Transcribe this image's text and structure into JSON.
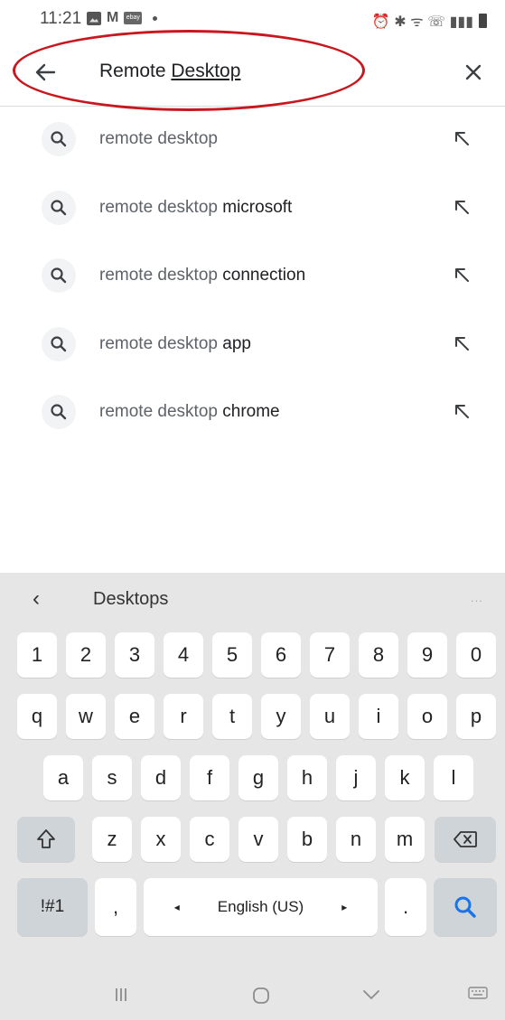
{
  "status_bar": {
    "time": "11:21",
    "gmail_icon": "M",
    "ebay_icon": "ebay",
    "right_icons": "⏰ ✱ ᯤ ☏ ▮▮▮"
  },
  "search": {
    "query_part1": "Remote ",
    "query_part2": "Desktop"
  },
  "suggestions": [
    {
      "prefix": "remote desktop",
      "suffix": ""
    },
    {
      "prefix": "remote desktop ",
      "suffix": "microsoft"
    },
    {
      "prefix": "remote desktop ",
      "suffix": "connection"
    },
    {
      "prefix": "remote desktop ",
      "suffix": "app"
    },
    {
      "prefix": "remote desktop ",
      "suffix": "chrome"
    }
  ],
  "keyboard": {
    "prediction": "Desktops",
    "more": "...",
    "row_numbers": [
      "1",
      "2",
      "3",
      "4",
      "5",
      "6",
      "7",
      "8",
      "9",
      "0"
    ],
    "row_q": [
      "q",
      "w",
      "e",
      "r",
      "t",
      "y",
      "u",
      "i",
      "o",
      "p"
    ],
    "row_a": [
      "a",
      "s",
      "d",
      "f",
      "g",
      "h",
      "j",
      "k",
      "l"
    ],
    "row_z": [
      "z",
      "x",
      "c",
      "v",
      "b",
      "n",
      "m"
    ],
    "symbols_label": "!#1",
    "comma": ",",
    "space_label": "English (US)",
    "space_left": "◂",
    "space_right": "▸",
    "period": "."
  },
  "colors": {
    "accent": "#1a73e8",
    "annotation": "#c8171e"
  }
}
